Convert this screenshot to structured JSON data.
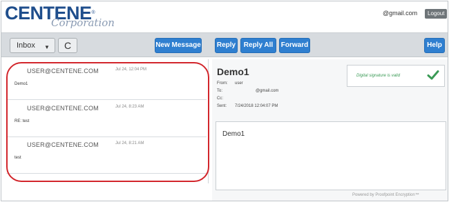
{
  "header": {
    "logo_main": "CENTENE",
    "logo_reg": "®",
    "logo_sub": "Corporation",
    "user_email": "@gmail.com",
    "logout_label": "Logout"
  },
  "toolbar": {
    "inbox_label": "Inbox",
    "caret": "▼",
    "refresh_glyph": "C",
    "new_message": "New Message",
    "reply": "Reply",
    "reply_all": "Reply All",
    "forward": "Forward",
    "help": "Help",
    "accent_color": "#2f7fd0"
  },
  "messages": [
    {
      "sender": "USER@CENTENE.COM",
      "date": "Jul 24, 12:04 PM",
      "subject": "Demo1"
    },
    {
      "sender": "USER@CENTENE.COM",
      "date": "Jul 24, 8:23 AM",
      "subject": "RE: test"
    },
    {
      "sender": "USER@CENTENE.COM",
      "date": "Jul 24, 8:21 AM",
      "subject": "test"
    }
  ],
  "annotation": {
    "highlight_color": "#d2242a"
  },
  "reading": {
    "subject": "Demo1",
    "from_label": "From:",
    "from_value": "user",
    "to_label": "To:",
    "to_value": "@gmail.com",
    "cc_label": "Cc:",
    "cc_value": "",
    "sent_label": "Sent:",
    "sent_value": "7/24/2018 12:04:07 PM",
    "signature_text": "Digital signature is valid",
    "signature_color": "#3a9a55",
    "body": "Demo1",
    "powered_by": "Powered by Proofpoint Encryption™"
  }
}
